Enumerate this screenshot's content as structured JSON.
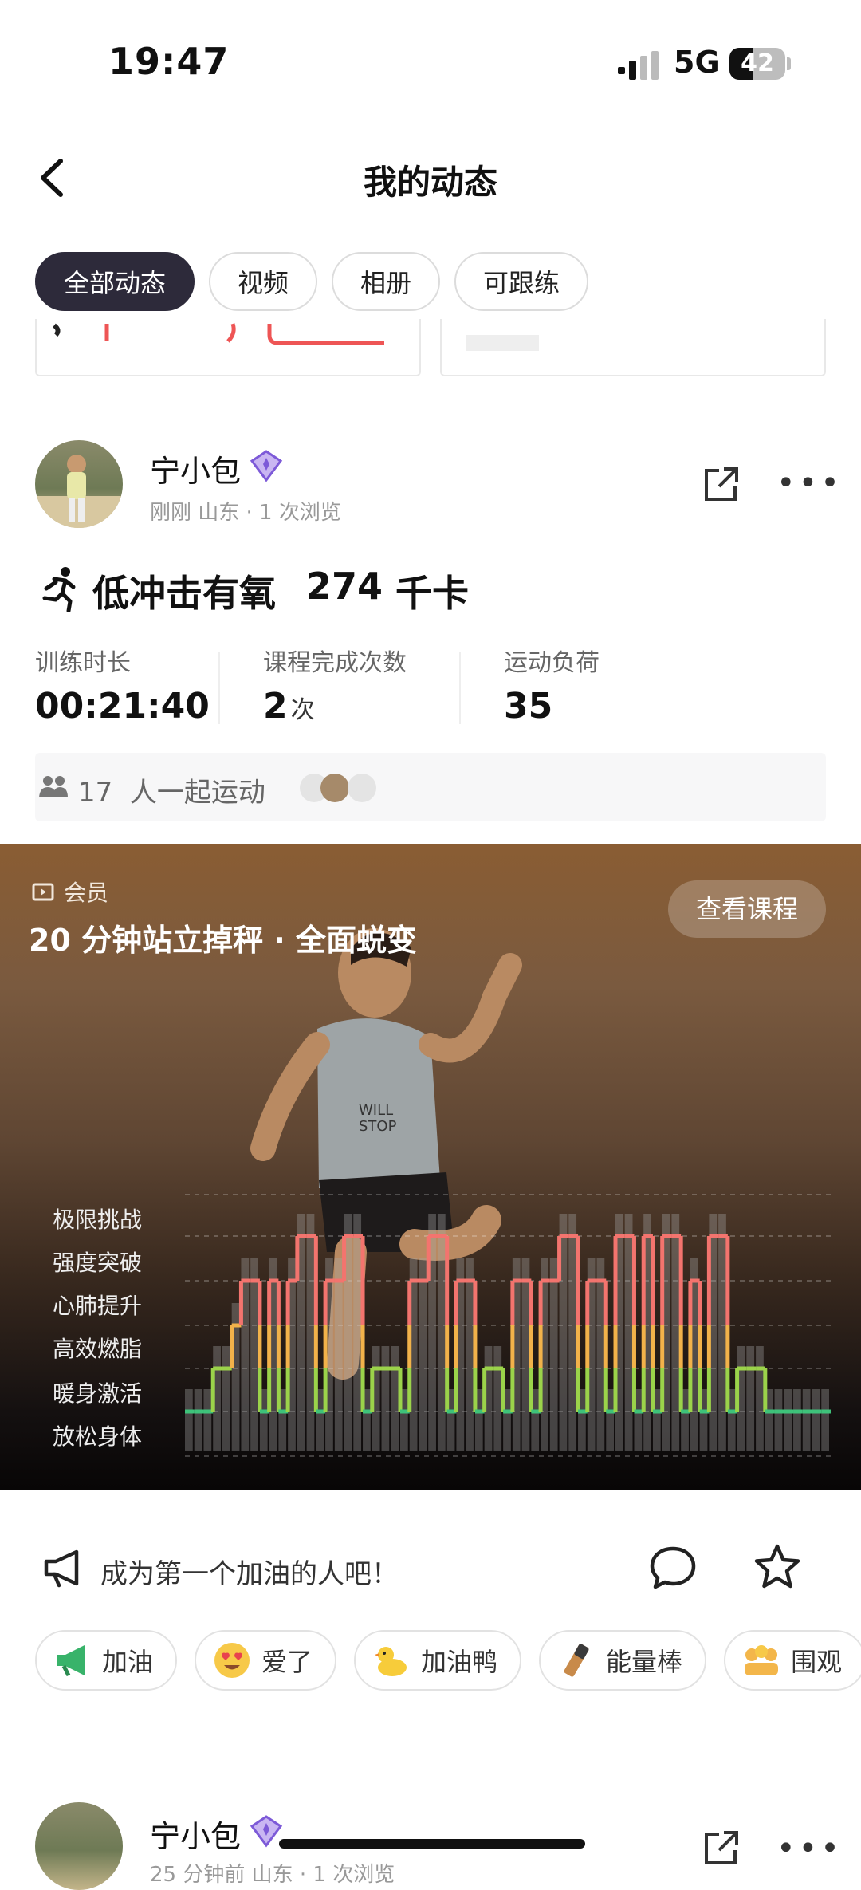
{
  "status_bar": {
    "time": "19:47",
    "network": "5G",
    "battery": "42"
  },
  "header": {
    "title": "我的动态"
  },
  "tabs": [
    {
      "label": "全部动态",
      "active": true
    },
    {
      "label": "视频",
      "active": false
    },
    {
      "label": "相册",
      "active": false
    },
    {
      "label": "可跟练",
      "active": false
    }
  ],
  "post": {
    "user_name": "宁小包",
    "meta": "刚刚 山东 · 1 次浏览",
    "workout": {
      "type": "低冲击有氧",
      "calories": "274",
      "calories_unit": "千卡"
    },
    "stats": [
      {
        "label": "训练时长",
        "value": "00:21:40",
        "unit": ""
      },
      {
        "label": "课程完成次数",
        "value": "2",
        "unit": "次"
      },
      {
        "label": "运动负荷",
        "value": "35",
        "unit": ""
      }
    ],
    "together": {
      "count": "17",
      "text": "人一起运动"
    },
    "course": {
      "badge": "会员",
      "title": "20 分钟站立掉秤 · 全面蜕变",
      "button": "查看课程",
      "levels": [
        "极限挑战",
        "强度突破",
        "心肺提升",
        "高效燃脂",
        "暖身激活",
        "放松身体"
      ]
    },
    "cheer_prompt": "成为第一个加油的人吧！",
    "reactions": [
      {
        "label": "加油",
        "icon": "megaphone-icon"
      },
      {
        "label": "爱了",
        "icon": "heart-eyes-icon"
      },
      {
        "label": "加油鸭",
        "icon": "duck-icon"
      },
      {
        "label": "能量棒",
        "icon": "energy-bar-icon"
      },
      {
        "label": "围观",
        "icon": "crowd-icon"
      }
    ]
  },
  "next_post": {
    "user_name": "宁小包",
    "meta": "25 分钟前 山东 · 1 次浏览"
  },
  "chart_data": {
    "type": "line",
    "y_categories": [
      "放松身体",
      "暖身激活",
      "高效燃脂",
      "心肺提升",
      "强度突破",
      "极限挑战"
    ],
    "values": [
      1,
      1,
      1,
      2,
      2,
      3,
      4,
      4,
      1,
      4,
      1,
      4,
      5,
      5,
      1,
      4,
      4,
      5,
      5,
      1,
      2,
      2,
      2,
      1,
      4,
      4,
      5,
      5,
      1,
      4,
      4,
      1,
      2,
      2,
      1,
      4,
      4,
      1,
      4,
      4,
      5,
      5,
      1,
      4,
      4,
      1,
      5,
      5,
      1,
      5,
      1,
      5,
      5,
      1,
      4,
      1,
      5,
      5,
      1,
      2,
      2,
      2,
      1,
      1,
      1,
      1,
      1,
      1,
      1
    ],
    "colors": {
      "放松身体": "#5a7bf5",
      "暖身激活": "#3ec27a",
      "高效燃脂": "#9bd34a",
      "心肺提升": "#f2b24a",
      "强度突破": "#f3746e",
      "极限挑战": "#f3746e"
    },
    "grid": true
  }
}
